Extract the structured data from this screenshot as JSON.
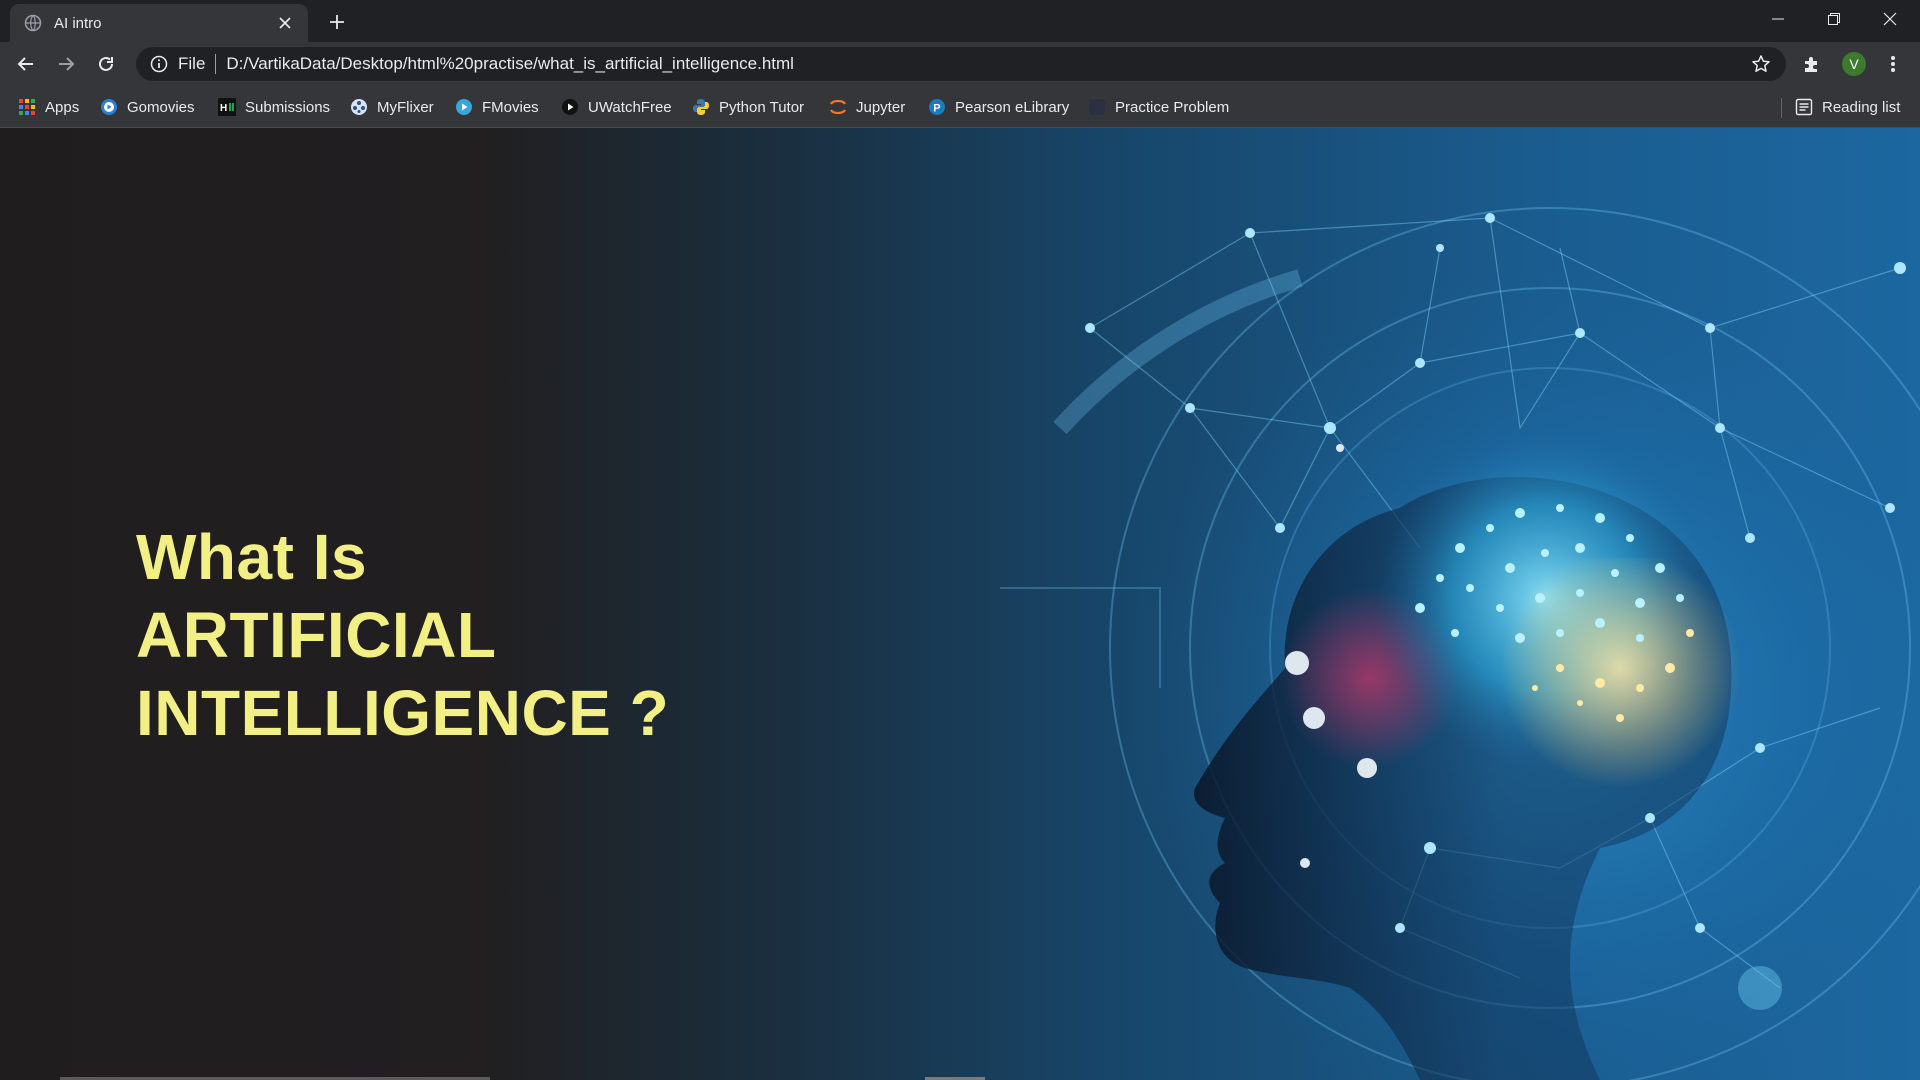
{
  "tab": {
    "title": "AI intro"
  },
  "address_bar": {
    "scheme_label": "File",
    "url": "D:/VartikaData/Desktop/html%20practise/what_is_artificial_intelligence.html"
  },
  "profile": {
    "initial": "V"
  },
  "bookmarks": {
    "apps": "Apps",
    "items": [
      "Gomovies",
      "Submissions",
      "MyFlixer",
      "FMovies",
      "UWatchFree",
      "Python Tutor",
      "Jupyter",
      "Pearson eLibrary",
      "Practice Problem"
    ],
    "reading_list": "Reading list"
  },
  "page": {
    "headline": [
      "What Is",
      "ARTIFICIAL",
      "INTELLIGENCE ?"
    ],
    "headline_color": "#f2ef84"
  },
  "colors": {
    "chrome_dark": "#202124",
    "chrome_toolbar": "#35363a",
    "accent_blue": "#1c67a0"
  }
}
